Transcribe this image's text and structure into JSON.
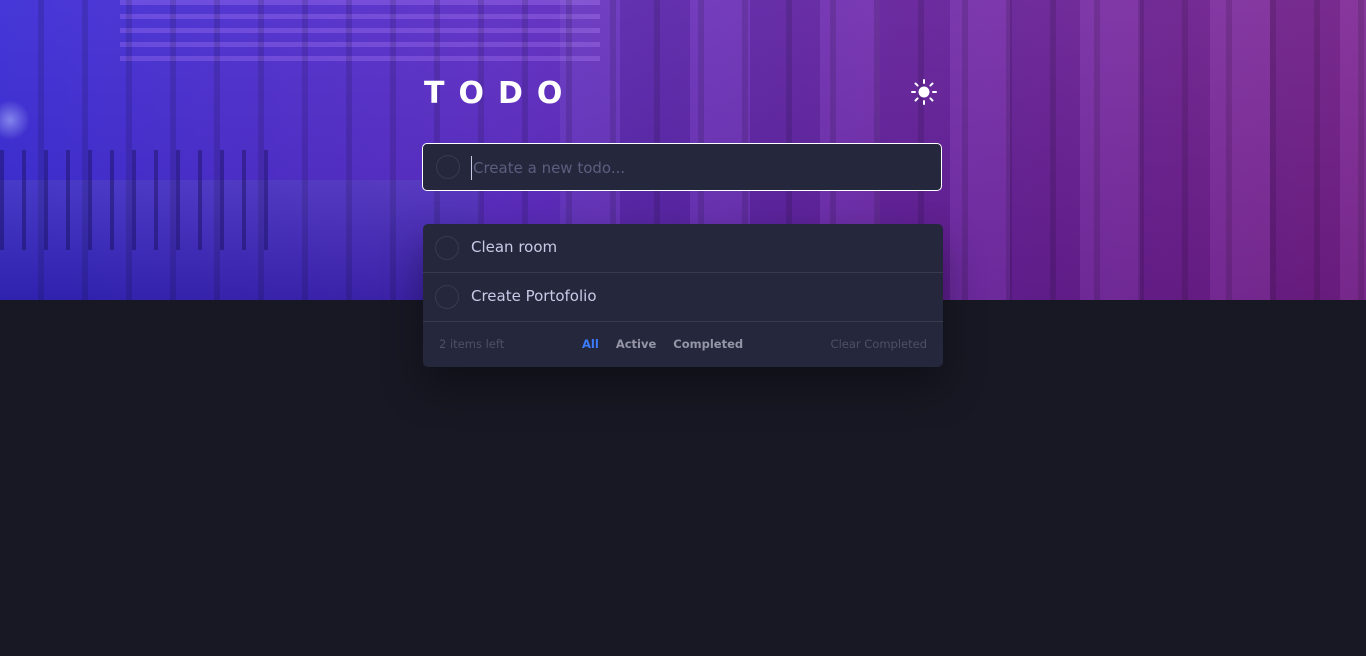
{
  "app": {
    "title": "TODO",
    "theme_icon": "sun-icon"
  },
  "new_todo": {
    "placeholder": "Create a new todo...",
    "value": ""
  },
  "todos": [
    {
      "label": "Clean room",
      "completed": false
    },
    {
      "label": "Create Portofolio",
      "completed": false
    }
  ],
  "footer": {
    "items_left": "2 items left",
    "filters": [
      "All",
      "Active",
      "Completed"
    ],
    "active_filter": "All",
    "clear_label": "Clear Completed"
  },
  "colors": {
    "accent": "#3a7cfd",
    "panel": "#25273c",
    "background": "#181824"
  }
}
